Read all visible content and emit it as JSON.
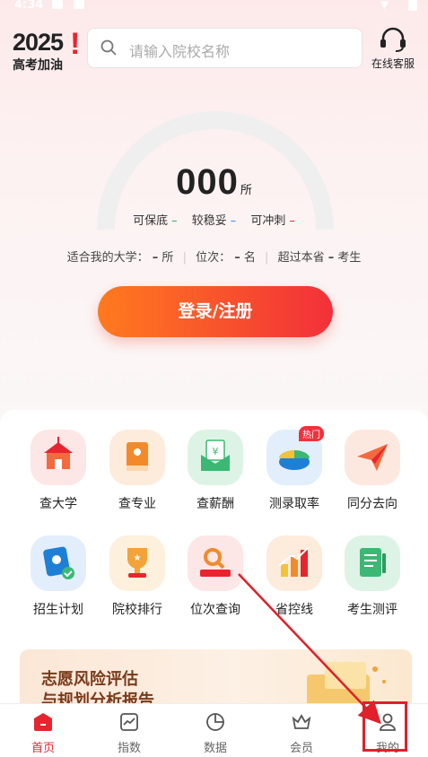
{
  "status_bar": {
    "time": "4:34"
  },
  "header": {
    "logo_year": "2025",
    "logo_subtitle": "高考加油",
    "search_placeholder": "请输入院校名称",
    "service_label": "在线客服"
  },
  "summary": {
    "count": "000",
    "count_unit": "所",
    "levels": [
      {
        "label": "可保底",
        "value": "–",
        "color": "#2aa86b"
      },
      {
        "label": "较稳妥",
        "value": "–",
        "color": "#2d8cf0"
      },
      {
        "label": "可冲刺",
        "value": "–",
        "color": "#e8242f"
      }
    ],
    "stats": {
      "fit_label": "适合我的大学：",
      "fit_value": "–",
      "fit_unit": "所",
      "rank_label": "位次：",
      "rank_value": "–",
      "rank_unit": "名",
      "exceed_label": "超过本省",
      "exceed_value": "–",
      "exceed_unit": "考生"
    },
    "login_button": "登录/注册"
  },
  "features": [
    {
      "label": "查大学",
      "icon": "school-icon",
      "bg": "#fde6e6"
    },
    {
      "label": "查专业",
      "icon": "book-icon",
      "bg": "#fdebdc"
    },
    {
      "label": "查薪酬",
      "icon": "salary-envelope-icon",
      "bg": "#ddf3e6"
    },
    {
      "label": "测录取率",
      "icon": "pie-chart-icon",
      "bg": "#e2eefb",
      "badge": "热门"
    },
    {
      "label": "同分去向",
      "icon": "paper-plane-icon",
      "bg": "#fde8df"
    },
    {
      "label": "招生计划",
      "icon": "enrollment-plan-icon",
      "bg": "#e2eefb"
    },
    {
      "label": "院校排行",
      "icon": "trophy-icon",
      "bg": "#fdf0dc"
    },
    {
      "label": "位次查询",
      "icon": "rank-search-icon",
      "bg": "#fde6e6"
    },
    {
      "label": "省控线",
      "icon": "province-line-icon",
      "bg": "#fdebdc"
    },
    {
      "label": "考生测评",
      "icon": "assessment-icon",
      "bg": "#ddf3e6"
    }
  ],
  "banner": {
    "line1": "志愿风险评估",
    "line2": "与规划分析报告"
  },
  "bottom_nav": [
    {
      "label": "首页",
      "icon": "home-icon",
      "active": true
    },
    {
      "label": "指数",
      "icon": "index-icon",
      "active": false
    },
    {
      "label": "数据",
      "icon": "data-icon",
      "active": false
    },
    {
      "label": "会员",
      "icon": "vip-icon",
      "active": false
    },
    {
      "label": "我的",
      "icon": "profile-icon",
      "active": false
    }
  ],
  "colors": {
    "accent": "#e8242f",
    "button_start": "#ff7a1e",
    "button_end": "#f2303a"
  }
}
